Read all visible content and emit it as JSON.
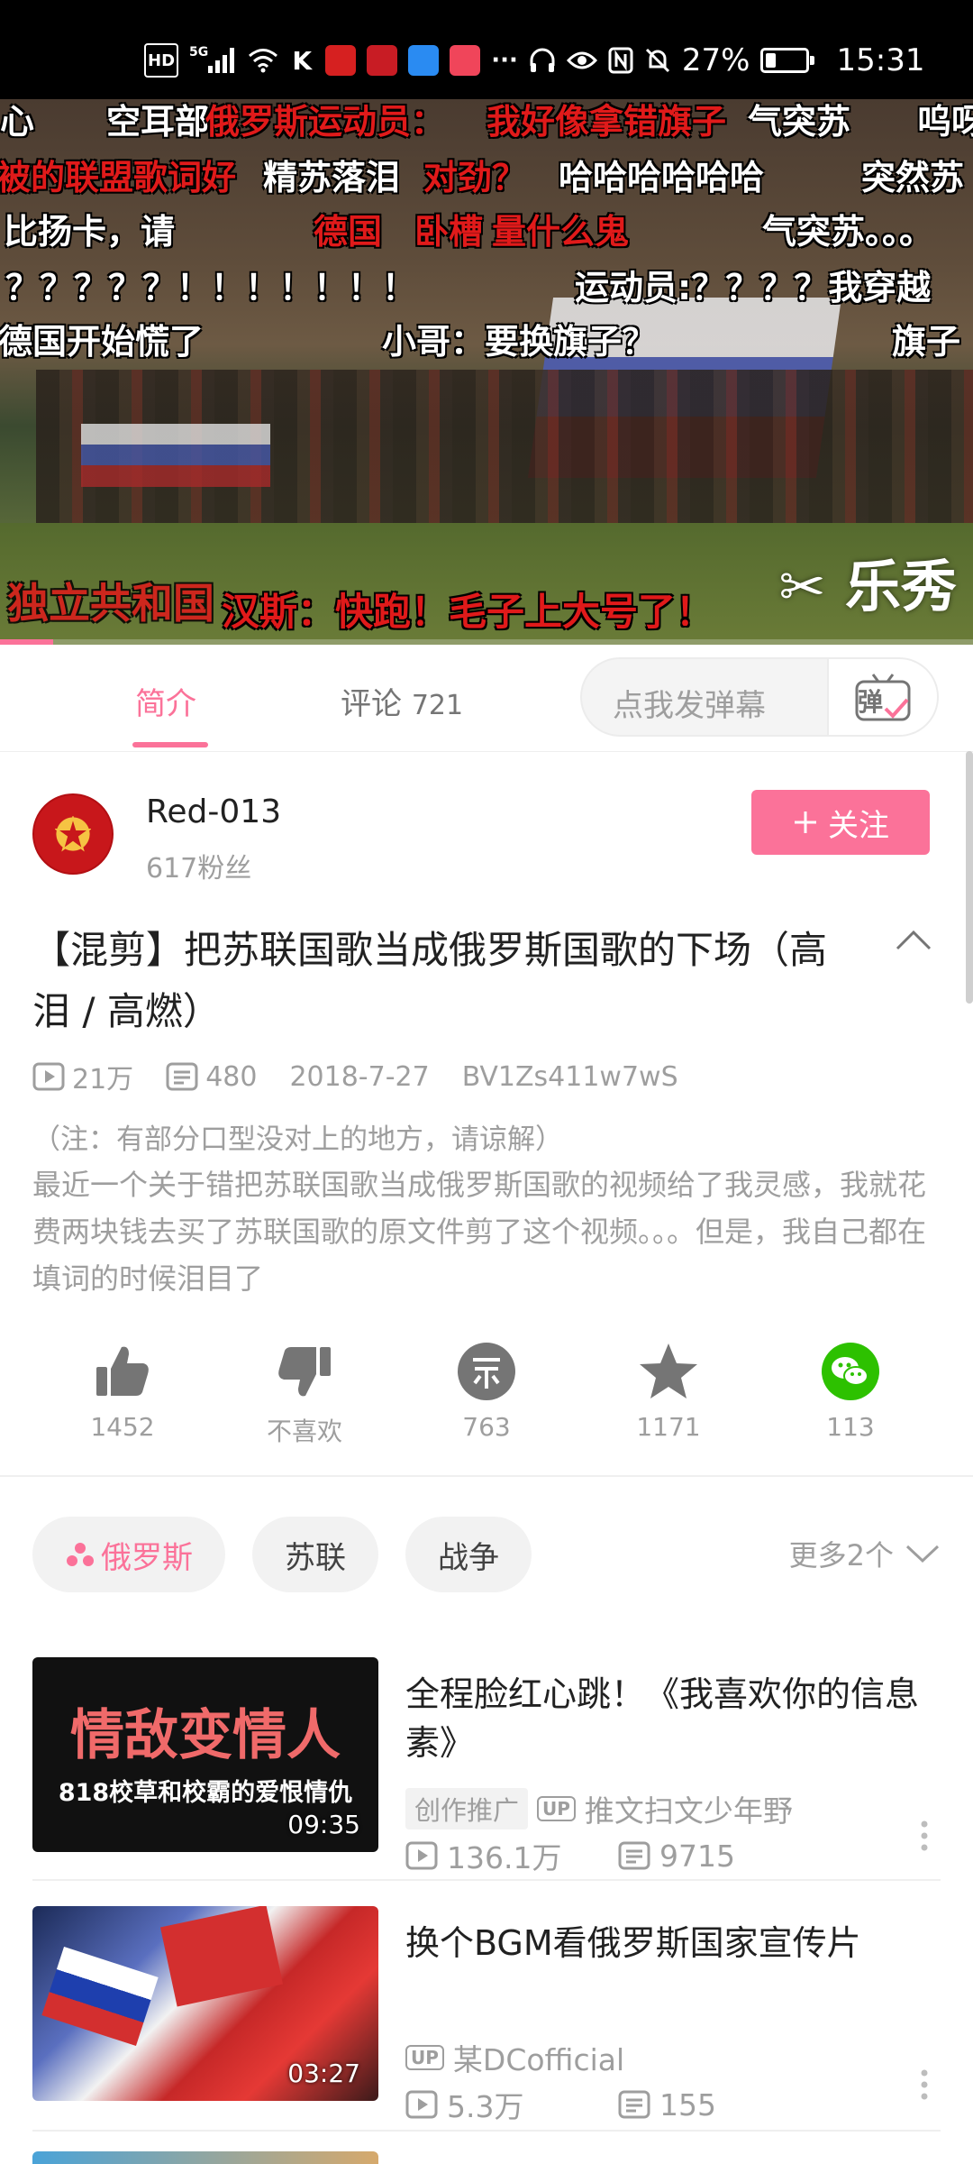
{
  "status_bar": {
    "network_badges": [
      "HD",
      "5G"
    ],
    "battery_percent": "27%",
    "battery_level": 0.27,
    "time": "15:31"
  },
  "player": {
    "danmaku": [
      {
        "text": "心",
        "color": "white"
      },
      {
        "text": "空耳部",
        "color": "white"
      },
      {
        "text": "俄罗斯运动员：",
        "color": "red"
      },
      {
        "text": "我好像拿错旗子",
        "color": "red"
      },
      {
        "text": "气突苏",
        "color": "white"
      },
      {
        "text": "呜呀",
        "color": "white"
      },
      {
        "text": "被的联盟歌词好",
        "color": "red"
      },
      {
        "text": "精苏落泪",
        "color": "white"
      },
      {
        "text": "对劲？",
        "color": "red"
      },
      {
        "text": "哈哈哈哈哈哈",
        "color": "white"
      },
      {
        "text": "突然苏",
        "color": "white"
      },
      {
        "text": "比扬卡，请",
        "color": "white"
      },
      {
        "text": "德国",
        "color": "red"
      },
      {
        "text": "卧槽",
        "color": "red"
      },
      {
        "text": "量什么鬼",
        "color": "red"
      },
      {
        "text": "气突苏。。。",
        "color": "white"
      },
      {
        "text": "？？？？？！！！！！！！",
        "color": "white"
      },
      {
        "text": "运动员:？？？？我穿越",
        "color": "white"
      },
      {
        "text": "德国开始慌了",
        "color": "white"
      },
      {
        "text": "小哥：要换旗子？",
        "color": "white"
      },
      {
        "text": "旗子",
        "color": "white"
      },
      {
        "text": "独立共和国",
        "color": "red"
      },
      {
        "text": "汉斯：快跑！毛子上大号了！",
        "color": "red"
      }
    ],
    "watermark": "乐秀",
    "progress": 0.055
  },
  "tabs": {
    "intro": "简介",
    "comments": "评论",
    "comments_count": "721",
    "danmaku_placeholder": "点我发弹幕",
    "danmaku_button_glyph": "弹"
  },
  "author": {
    "name": "Red-013",
    "fans": "617粉丝",
    "follow_label": "关注"
  },
  "video": {
    "title": "【混剪】把苏联国歌当成俄罗斯国歌的下场（高泪 / 高燃）",
    "views": "21万",
    "danmaku_count": "480",
    "date": "2018-7-27",
    "bvid": "BV1Zs411w7wS",
    "note": "（注：有部分口型没对上的地方，请谅解）",
    "description": "最近一个关于错把苏联国歌当成俄罗斯国歌的视频给了我灵感，我就花费两块钱去买了苏联国歌的原文件剪了这个视频。。。但是，我自己都在填词的时候泪目了"
  },
  "actions": {
    "like": "1452",
    "dislike": "不喜欢",
    "coin": "763",
    "favorite": "1171",
    "share": "113"
  },
  "tags": {
    "items": [
      "俄罗斯",
      "苏联",
      "战争"
    ],
    "more": "更多2个"
  },
  "recommendations": [
    {
      "thumb_title": "情敌变情人",
      "thumb_subtitle": "818校草和校霸的爱恨情仇",
      "duration": "09:35",
      "title": "全程脸红心跳！《我喜欢你的信息素》",
      "badge": "创作推广",
      "up_label": "UP",
      "uploader": "推文扫文少年野",
      "views": "136.1万",
      "danmaku": "9715"
    },
    {
      "duration": "03:27",
      "title": "换个BGM看俄罗斯国家宣传片",
      "up_label": "UP",
      "uploader": "某DCofficial",
      "views": "5.3万",
      "danmaku": "155"
    }
  ],
  "colors": {
    "accent": "#fb7299",
    "danmaku_red": "#e01a1a",
    "wechat_green": "#2dc100",
    "icon_gray": "#757575"
  },
  "icons": [
    "signal-icon",
    "wifi-icon",
    "headphones-icon",
    "eye-icon",
    "nfc-icon",
    "mute-icon",
    "battery-icon",
    "play-count-icon",
    "danmaku-count-icon",
    "like-icon",
    "dislike-icon",
    "coin-icon",
    "favorite-icon",
    "wechat-icon",
    "chevron-up-icon",
    "chevron-down-icon",
    "more-vertical-icon",
    "plus-icon"
  ]
}
